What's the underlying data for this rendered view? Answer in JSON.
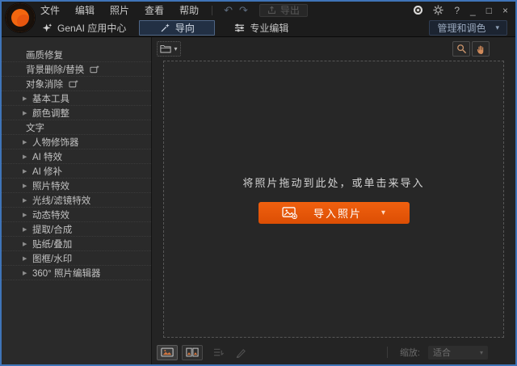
{
  "titlebar": {
    "menus": [
      "文件",
      "编辑",
      "照片",
      "查看",
      "帮助"
    ],
    "export_label": "导出"
  },
  "nav": {
    "genai_label": "GenAI 应用中心",
    "guided_label": "导向",
    "pro_edit_label": "专业编辑",
    "manage_label": "管理和调色"
  },
  "sidebar": {
    "items": [
      {
        "label": "画质修复"
      },
      {
        "label": "背景删除/替换"
      },
      {
        "label": "对象消除"
      },
      {
        "label": "基本工具"
      },
      {
        "label": "颜色调整"
      },
      {
        "label": "文字"
      },
      {
        "label": "人物修饰器"
      },
      {
        "label": "AI 特效"
      },
      {
        "label": "AI 修补"
      },
      {
        "label": "照片特效"
      },
      {
        "label": "光线/滤镜特效"
      },
      {
        "label": "动态特效"
      },
      {
        "label": "提取/合成"
      },
      {
        "label": "贴纸/叠加"
      },
      {
        "label": "图框/水印"
      },
      {
        "label": "360° 照片编辑器"
      }
    ]
  },
  "canvas": {
    "drop_hint": "将照片拖动到此处，或单击来导入",
    "import_label": "导入照片"
  },
  "statusbar": {
    "zoom_label": "缩放:",
    "zoom_value": "适合"
  },
  "icons": {
    "expander": "▶",
    "chevron_down": "▾",
    "undo": "↶",
    "redo": "↷",
    "help": "?",
    "minimize": "_",
    "maximize": "□",
    "close": "×"
  },
  "colors": {
    "accent_orange": "#e8560e",
    "selected_nav_bg": "#223044",
    "window_border": "#3f74b8"
  }
}
